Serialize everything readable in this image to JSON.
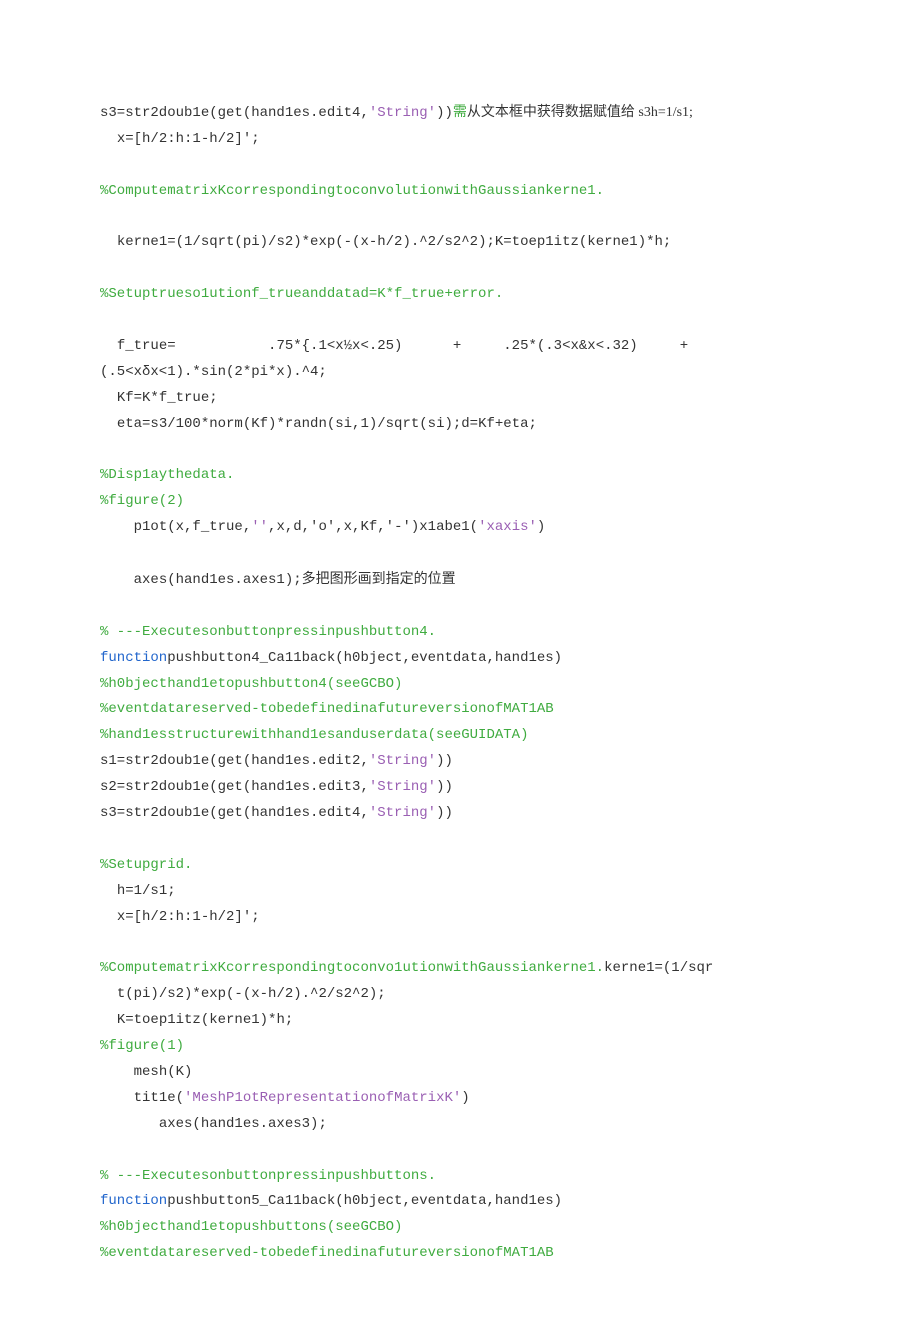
{
  "lines": [
    {
      "segs": [
        {
          "t": "s3=str2doub1e(get(hand1es.edit4,"
        },
        {
          "t": "'String'",
          "c": "str"
        },
        {
          "t": "))"
        },
        {
          "t": "需",
          "c": "comment cn"
        },
        {
          "t": "从文本框中获得数据赋值给 s3h=1/s1;",
          "c": "cn"
        }
      ]
    },
    {
      "segs": [
        {
          "t": "  x=[h/2:h:1-h/2]';"
        }
      ]
    },
    {
      "blank": true
    },
    {
      "segs": [
        {
          "t": "%ComputematrixKcorrespondingtoconvolutionwithGaussiankerne1.",
          "c": "comment"
        }
      ]
    },
    {
      "blank": true
    },
    {
      "segs": [
        {
          "t": "  kerne1=(1/sqrt(pi)/s2)*exp(-(x-h/2).^2/s2^2);K=toep1itz(kerne1)*h;"
        }
      ]
    },
    {
      "blank": true
    },
    {
      "segs": [
        {
          "t": "%Setuptrueso1utionf_trueanddatad=K*f_true+error.",
          "c": "comment"
        }
      ]
    },
    {
      "blank": true
    },
    {
      "segs": [
        {
          "t": "  f_true=           .75*{.1<x½x<.25)      +     .25*(.3<x&x<.32)     +"
        }
      ]
    },
    {
      "segs": [
        {
          "t": "(.5<xδx<1).*sin(2*pi*x).^4;"
        }
      ]
    },
    {
      "segs": [
        {
          "t": "  Kf=K*f_true;"
        }
      ]
    },
    {
      "segs": [
        {
          "t": "  eta=s3/100*norm(Kf)*randn(si,1)/sqrt(si);d=Kf+eta;"
        }
      ]
    },
    {
      "blank": true
    },
    {
      "segs": [
        {
          "t": "%Disp1aythedata.",
          "c": "comment"
        }
      ]
    },
    {
      "segs": [
        {
          "t": "%figure(2)",
          "c": "comment"
        }
      ]
    },
    {
      "segs": [
        {
          "t": "    p1ot(x,f_true,"
        },
        {
          "t": "''",
          "c": "str"
        },
        {
          "t": ",x,d,'o',x,Kf,'-')x1abe1("
        },
        {
          "t": "'xaxis'",
          "c": "str"
        },
        {
          "t": ")"
        }
      ]
    },
    {
      "blank": true
    },
    {
      "segs": [
        {
          "t": "    axes(hand1es.axes1);"
        },
        {
          "t": "多把图形画到指定的位置",
          "c": "cn"
        }
      ]
    },
    {
      "blank": true
    },
    {
      "segs": [
        {
          "t": "% ---",
          "c": "comment"
        },
        {
          "t": "Executesonbuttonpressinpushbutton4.",
          "c": "comment"
        }
      ]
    },
    {
      "segs": [
        {
          "t": "function",
          "c": "kw"
        },
        {
          "t": "pushbutton4_Ca11back(h0bject,eventdata,hand1es)"
        }
      ]
    },
    {
      "segs": [
        {
          "t": "%h0bjecthand1etopushbutton4(seeGCBO)",
          "c": "comment"
        }
      ]
    },
    {
      "segs": [
        {
          "t": "%eventdatareserved-tobedefinedinafutureversionofMAT1AB",
          "c": "comment"
        }
      ]
    },
    {
      "segs": [
        {
          "t": "%hand1esstructurewithhand1esanduserdata(seeGUIDATA)",
          "c": "comment"
        }
      ]
    },
    {
      "segs": [
        {
          "t": "s1=str2doub1e(get(hand1es.edit2,"
        },
        {
          "t": "'String'",
          "c": "str"
        },
        {
          "t": "))"
        }
      ]
    },
    {
      "segs": [
        {
          "t": "s2=str2doub1e(get(hand1es.edit3,"
        },
        {
          "t": "'String'",
          "c": "str"
        },
        {
          "t": "))"
        }
      ]
    },
    {
      "segs": [
        {
          "t": "s3=str2doub1e(get(hand1es.edit4,"
        },
        {
          "t": "'String'",
          "c": "str"
        },
        {
          "t": "))"
        }
      ]
    },
    {
      "blank": true
    },
    {
      "segs": [
        {
          "t": "%Setupgrid.",
          "c": "comment"
        }
      ]
    },
    {
      "segs": [
        {
          "t": "  h=1/s1;"
        }
      ]
    },
    {
      "segs": [
        {
          "t": "  x=[h/2:h:1-h/2]';"
        }
      ]
    },
    {
      "blank": true
    },
    {
      "segs": [
        {
          "t": "%ComputematrixKcorrespondingtoconvo1utionwithGaussiankerne1.",
          "c": "comment"
        },
        {
          "t": "kerne1=(1/sqr"
        }
      ]
    },
    {
      "segs": [
        {
          "t": "  t(pi)/s2)*exp(-(x-h/2).^2/s2^2);"
        }
      ]
    },
    {
      "segs": [
        {
          "t": "  K=toep1itz(kerne1)*h;"
        }
      ]
    },
    {
      "segs": [
        {
          "t": "%figure(1)",
          "c": "comment"
        }
      ]
    },
    {
      "segs": [
        {
          "t": "    mesh(K)"
        }
      ]
    },
    {
      "segs": [
        {
          "t": "    tit1e("
        },
        {
          "t": "'MeshP1otRepresentationofMatrixK'",
          "c": "str"
        },
        {
          "t": ")"
        }
      ]
    },
    {
      "segs": [
        {
          "t": "       axes(hand1es.axes3);"
        }
      ]
    },
    {
      "blank": true
    },
    {
      "segs": [
        {
          "t": "% ---",
          "c": "comment"
        },
        {
          "t": "Executesonbuttonpressinpushbuttons.",
          "c": "comment"
        }
      ]
    },
    {
      "segs": [
        {
          "t": "function",
          "c": "kw"
        },
        {
          "t": "pushbutton5_Ca11back(h0bject,eventdata,hand1es)"
        }
      ]
    },
    {
      "segs": [
        {
          "t": "%h0bjecthand1etopushbuttons(seeGCBO)",
          "c": "comment"
        }
      ]
    },
    {
      "segs": [
        {
          "t": "%eventdatareserved-tobedefinedinafutureversionofMAT1AB",
          "c": "comment"
        }
      ]
    }
  ]
}
